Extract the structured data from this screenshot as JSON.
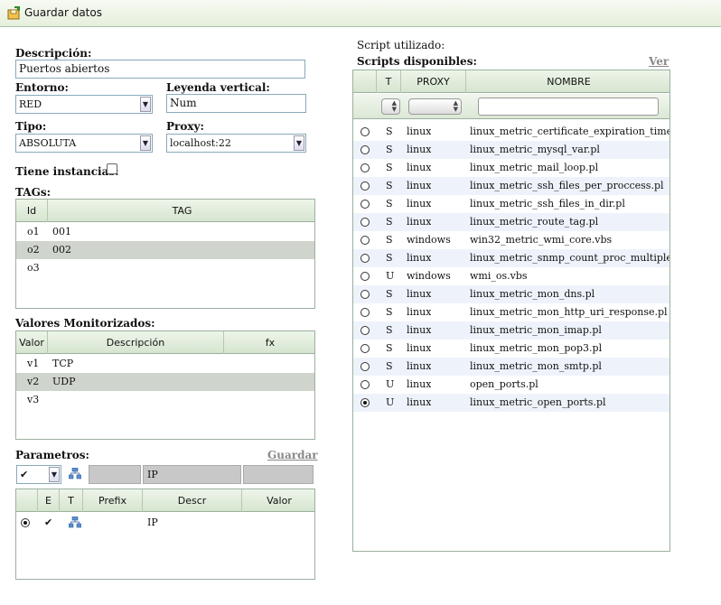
{
  "toolbar": {
    "title": "Guardar datos"
  },
  "form": {
    "descripcion_label": "Descripción:",
    "descripcion_value": "Puertos abiertos",
    "entorno_label": "Entorno:",
    "entorno_value": "RED",
    "leyenda_label": "Leyenda vertical:",
    "leyenda_value": "Num",
    "tipo_label": "Tipo:",
    "tipo_value": "ABSOLUTA",
    "proxy_label": "Proxy:",
    "proxy_value": "localhost:22",
    "instancias_label": "Tiene instancias:"
  },
  "tags": {
    "label": "TAGs:",
    "headers": [
      "Id",
      "TAG"
    ],
    "rows": [
      {
        "id": "o1",
        "tag": "001"
      },
      {
        "id": "o2",
        "tag": "002"
      },
      {
        "id": "o3",
        "tag": ""
      }
    ]
  },
  "valores": {
    "label": "Valores Monitorizados:",
    "headers": [
      "Valor",
      "Descripción",
      "fx"
    ],
    "rows": [
      {
        "valor": "v1",
        "descripcion": "TCP"
      },
      {
        "valor": "v2",
        "descripcion": "UDP"
      },
      {
        "valor": "v3",
        "descripcion": ""
      }
    ]
  },
  "parametros": {
    "label": "Parametros:",
    "guardar": "Guardar",
    "check_value": "✔",
    "ip_field": "IP",
    "headers": [
      "E",
      "T",
      "Prefix",
      "Descr",
      "Valor"
    ],
    "rows": [
      {
        "e": "✔",
        "descr": "IP"
      }
    ]
  },
  "scripts": {
    "utilizado_label": "Script utilizado:",
    "disponibles_label": "Scripts disponibles:",
    "ver_link": "Ver",
    "headers": [
      "T",
      "PROXY",
      "NOMBRE"
    ],
    "rows": [
      {
        "t": "S",
        "proxy": "linux",
        "nombre": "linux_metric_certificate_expiration_time.pl"
      },
      {
        "t": "S",
        "proxy": "linux",
        "nombre": "linux_metric_mysql_var.pl"
      },
      {
        "t": "S",
        "proxy": "linux",
        "nombre": "linux_metric_mail_loop.pl"
      },
      {
        "t": "S",
        "proxy": "linux",
        "nombre": "linux_metric_ssh_files_per_proccess.pl"
      },
      {
        "t": "S",
        "proxy": "linux",
        "nombre": "linux_metric_ssh_files_in_dir.pl"
      },
      {
        "t": "S",
        "proxy": "linux",
        "nombre": "linux_metric_route_tag.pl"
      },
      {
        "t": "S",
        "proxy": "windows",
        "nombre": "win32_metric_wmi_core.vbs"
      },
      {
        "t": "S",
        "proxy": "linux",
        "nombre": "linux_metric_snmp_count_proc_multiple_d"
      },
      {
        "t": "U",
        "proxy": "windows",
        "nombre": "wmi_os.vbs"
      },
      {
        "t": "S",
        "proxy": "linux",
        "nombre": "linux_metric_mon_dns.pl"
      },
      {
        "t": "S",
        "proxy": "linux",
        "nombre": "linux_metric_mon_http_uri_response.pl"
      },
      {
        "t": "S",
        "proxy": "linux",
        "nombre": "linux_metric_mon_imap.pl"
      },
      {
        "t": "S",
        "proxy": "linux",
        "nombre": "linux_metric_mon_pop3.pl"
      },
      {
        "t": "S",
        "proxy": "linux",
        "nombre": "linux_metric_mon_smtp.pl"
      },
      {
        "t": "U",
        "proxy": "linux",
        "nombre": "open_ports.pl"
      },
      {
        "t": "U",
        "proxy": "linux",
        "nombre": "linux_metric_open_ports.pl",
        "selected": true
      }
    ]
  }
}
